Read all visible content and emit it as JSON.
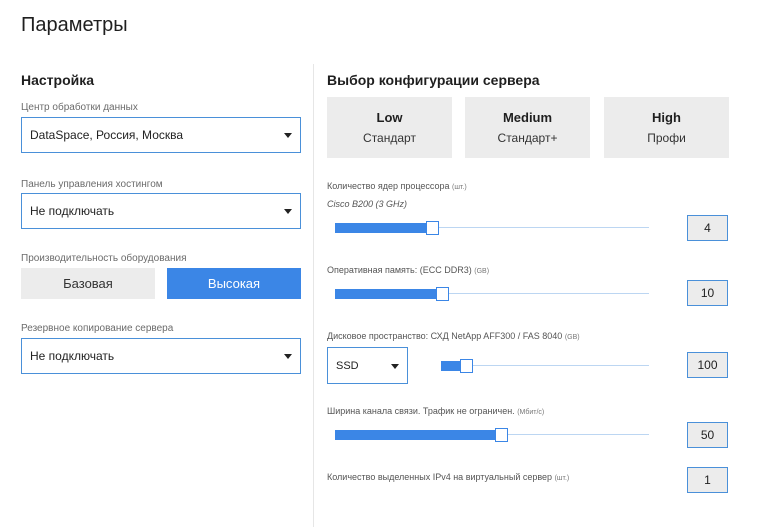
{
  "title": "Параметры",
  "left": {
    "section_title": "Настройка",
    "datacenter": {
      "label": "Центр обработки данных",
      "value": "DataSpace, Россия, Москва"
    },
    "panel": {
      "label": "Панель управления хостингом",
      "value": "Не подключать"
    },
    "performance": {
      "label": "Производительность оборудования",
      "options": [
        "Базовая",
        "Высокая"
      ],
      "selected": "Высокая"
    },
    "backup": {
      "label": "Резервное копирование сервера",
      "value": "Не подключать"
    }
  },
  "right": {
    "section_title": "Выбор конфигурации сервера",
    "configs": [
      {
        "name": "Low",
        "sub": "Стандарт"
      },
      {
        "name": "Medium",
        "sub": "Стандарт+"
      },
      {
        "name": "High",
        "sub": "Профи"
      }
    ],
    "cpu": {
      "label": "Количество ядер процессора",
      "unit": "(шт.)",
      "sub": "Cisco B200 (3 GHz)",
      "value": "4",
      "fill_fraction": 0.31
    },
    "ram": {
      "label": "Оперативная память: (ECC DDR3)",
      "unit": "(GB)",
      "value": "10",
      "fill_fraction": 0.34
    },
    "disk": {
      "label": "Дисковое пространство: СХД NetApp AFF300 / FAS 8040",
      "unit": "(GB)",
      "type": "SSD",
      "value": "100",
      "fill_fraction": 0.12
    },
    "bandwidth": {
      "label": "Ширина канала связи. Трафик не ограничен.",
      "unit": "(Мбит/с)",
      "value": "50",
      "fill_fraction": 0.53
    },
    "ipv4": {
      "label": "Количество выделенных IPv4 на виртуальный сервер",
      "unit": "(шт.)",
      "value": "1"
    }
  }
}
